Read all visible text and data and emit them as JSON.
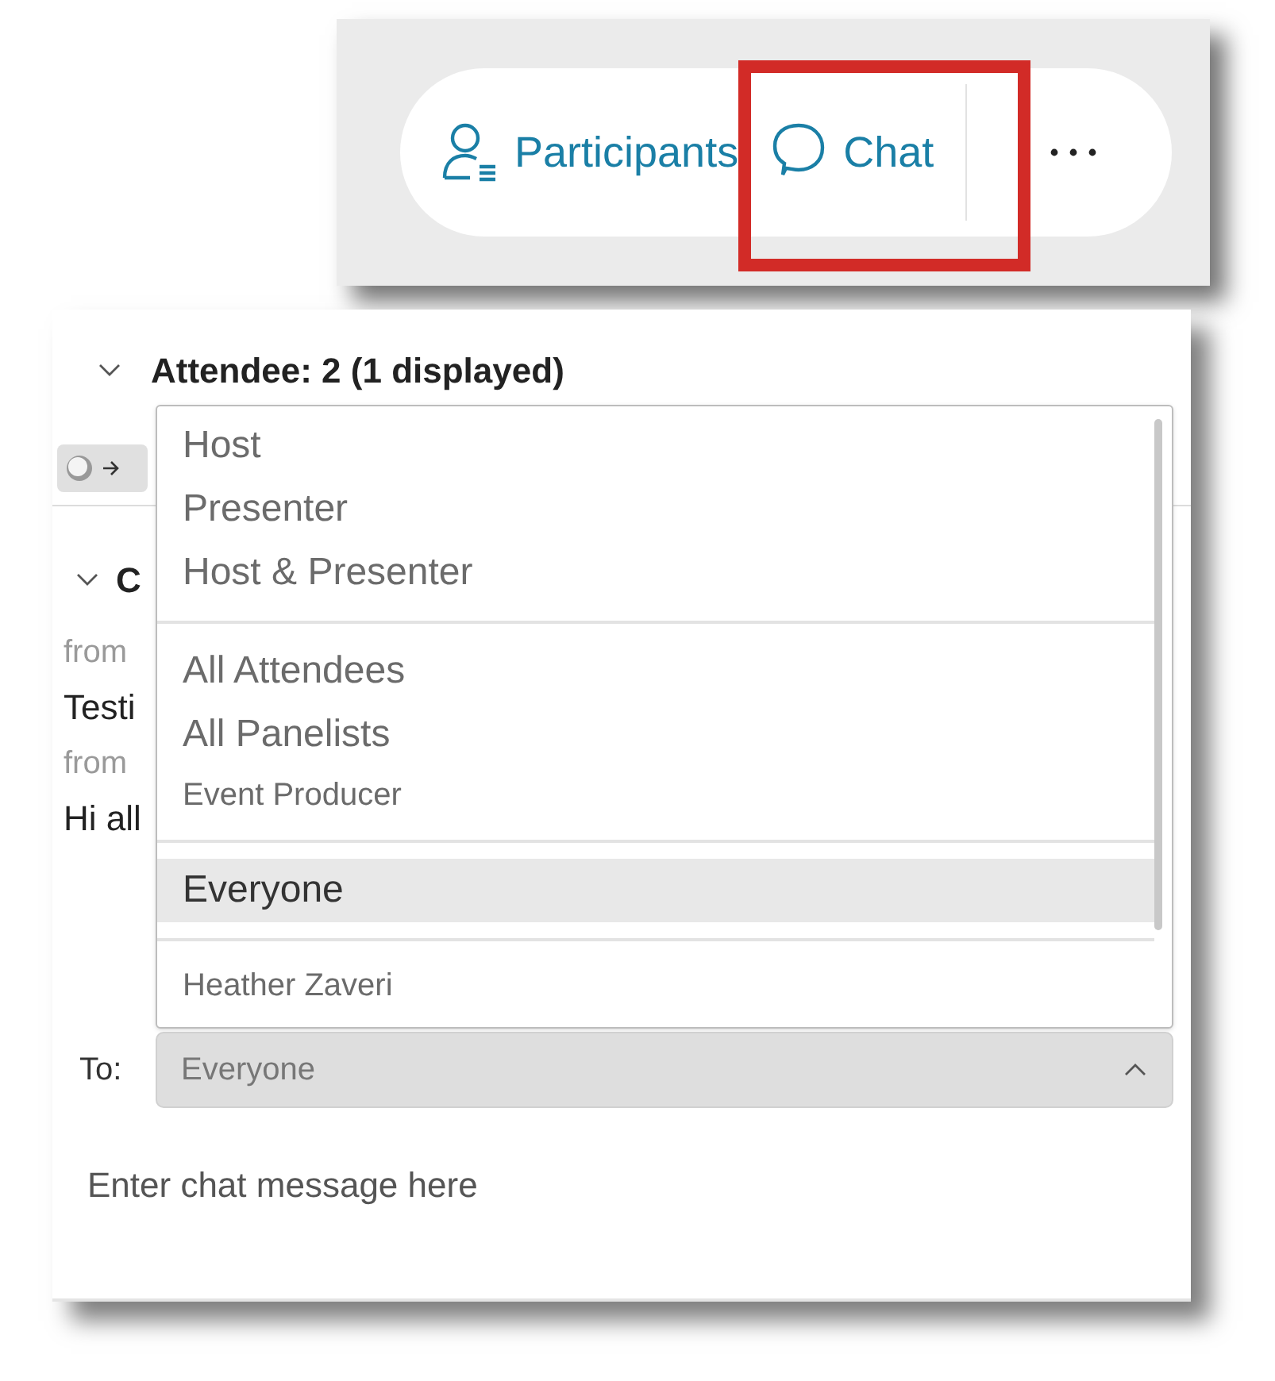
{
  "toolbar": {
    "buttons": [
      {
        "kind": "participants",
        "label": "Participants",
        "highlighted": false
      },
      {
        "kind": "chat",
        "label": "Chat",
        "highlighted": true
      }
    ]
  },
  "attendees": {
    "title": "Attendee: 2 (1 displayed)",
    "expanded": true
  },
  "chat": {
    "title": "C",
    "expanded": true,
    "messages": [
      {
        "from": "from",
        "text": "Testi"
      },
      {
        "from": "from",
        "text": "Hi all"
      }
    ]
  },
  "recipient_menu": {
    "groups": [
      {
        "items": [
          {
            "label": "Host",
            "kind": "option",
            "selected": false
          },
          {
            "label": "Presenter",
            "kind": "option",
            "selected": false
          },
          {
            "label": "Host & Presenter",
            "kind": "option",
            "selected": false
          }
        ]
      },
      {
        "items": [
          {
            "label": "All Attendees",
            "kind": "option",
            "selected": false
          },
          {
            "label": "All Panelists",
            "kind": "option",
            "selected": false
          },
          {
            "label": "Event Producer",
            "kind": "sub_option",
            "selected": false
          }
        ]
      },
      {
        "items": [
          {
            "label": "Everyone",
            "kind": "option",
            "selected": true
          }
        ]
      },
      {
        "items": [
          {
            "label": "Heather Zaveri",
            "kind": "sub_option",
            "selected": false
          }
        ]
      }
    ]
  },
  "to": {
    "label": "To:",
    "value": "Everyone",
    "open": true
  },
  "composer": {
    "placeholder": "Enter chat message here"
  }
}
